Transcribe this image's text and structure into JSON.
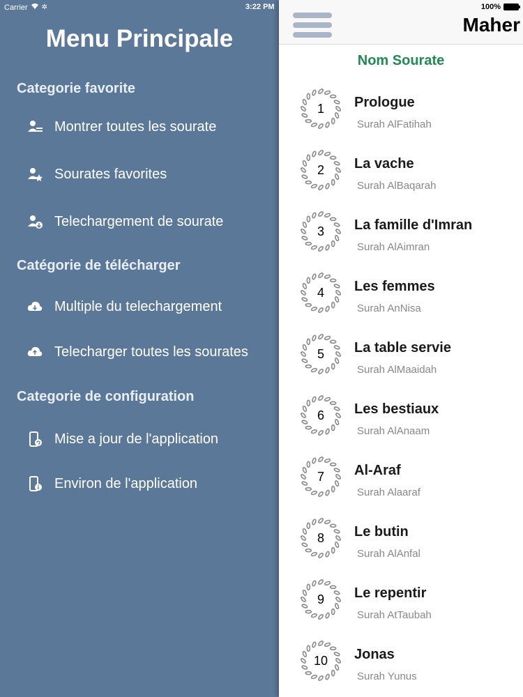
{
  "status": {
    "carrier": "Carrier",
    "time": "3:22 PM",
    "battery": "100%"
  },
  "menu": {
    "title": "Menu Principale",
    "categories": [
      {
        "title": "Categorie favorite",
        "items": [
          {
            "label": "Montrer toutes les sourate",
            "icon": "users-list-icon"
          },
          {
            "label": "Sourates favorites",
            "icon": "users-star-icon"
          },
          {
            "label": "Telechargement de sourate",
            "icon": "users-download-icon"
          }
        ]
      },
      {
        "title": "Catégorie de télécharger",
        "items": [
          {
            "label": "Multiple du telechargement",
            "icon": "cloud-download-icon"
          },
          {
            "label": "Telecharger toutes les sourates",
            "icon": "cloud-upload-icon"
          }
        ]
      },
      {
        "title": "Categorie de configuration",
        "items": [
          {
            "label": "Mise a jour de l'application",
            "icon": "phone-update-icon"
          },
          {
            "label": "Environ de l'application",
            "icon": "phone-info-icon"
          }
        ]
      }
    ]
  },
  "panel": {
    "title": "Maher",
    "column_header": "Nom Sourate",
    "surahs": [
      {
        "number": "1",
        "name": "Prologue",
        "subtitle": "Surah AlFatihah"
      },
      {
        "number": "2",
        "name": "La vache",
        "subtitle": "Surah AlBaqarah"
      },
      {
        "number": "3",
        "name": "La famille d'Imran",
        "subtitle": "Surah AlAimran"
      },
      {
        "number": "4",
        "name": "Les femmes",
        "subtitle": "Surah AnNisa"
      },
      {
        "number": "5",
        "name": "La table servie",
        "subtitle": "Surah AlMaaidah"
      },
      {
        "number": "6",
        "name": "Les bestiaux",
        "subtitle": "Surah AlAnaam"
      },
      {
        "number": "7",
        "name": "Al-Araf",
        "subtitle": "Surah Alaaraf"
      },
      {
        "number": "8",
        "name": "Le butin",
        "subtitle": "Surah AlAnfal"
      },
      {
        "number": "9",
        "name": "Le repentir",
        "subtitle": "Surah AtTaubah"
      },
      {
        "number": "10",
        "name": "Jonas",
        "subtitle": "Surah Yunus"
      }
    ]
  },
  "colors": {
    "menu_bg": "#5c7899",
    "accent_green": "#1f8a52",
    "hamburger": "#aab6c8"
  }
}
